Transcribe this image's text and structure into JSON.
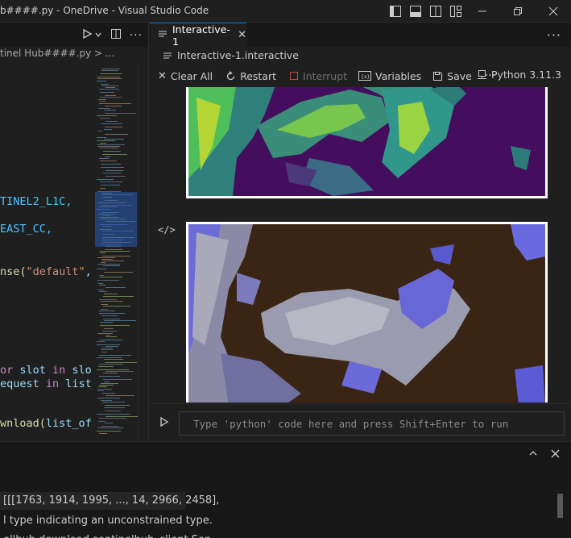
{
  "window": {
    "title": "b####.py - OneDrive - Visual Studio Code"
  },
  "left_editor": {
    "breadcrumb": "tinel Hub####.py > ...",
    "code_lines": [
      {
        "segments": [
          {
            "t": "TINEL2_L1C,",
            "c": "const"
          }
        ]
      },
      {
        "segments": [
          {
            "t": "EAST_CC,",
            "c": "const"
          }
        ]
      },
      {
        "segments": [
          {
            "t": "nse(",
            "c": "fn"
          },
          {
            "t": "\"default\"",
            "c": "str"
          },
          {
            "t": ", M",
            "c": "var"
          }
        ]
      },
      {
        "segments": [
          {
            "t": "or ",
            "c": "kw"
          },
          {
            "t": "slot ",
            "c": "var"
          },
          {
            "t": "in ",
            "c": "kw"
          },
          {
            "t": "slots",
            "c": "var"
          }
        ]
      },
      {
        "segments": [
          {
            "t": "equest ",
            "c": "var"
          },
          {
            "t": "in ",
            "c": "kw"
          },
          {
            "t": "list_o",
            "c": "var"
          }
        ]
      },
      {
        "segments": [
          {
            "t": "wnload(",
            "c": "fn"
          },
          {
            "t": "list_of_re",
            "c": "var"
          }
        ]
      }
    ]
  },
  "interactive": {
    "tab_label": "Interactive-1",
    "breadcrumb": "Interactive-1.interactive",
    "toolbar": {
      "clear_all": "Clear All",
      "restart": "Restart",
      "interrupt": "Interrupt",
      "variables": "Variables",
      "save": "Save",
      "kernel": "Python 3.11.3"
    },
    "input_placeholder": "Type 'python' code here and press Shift+Enter to run"
  },
  "bottom_panel": {
    "lines": [
      "[[[1763, 1914, 1995, ...,  14, 2966, 2458],",
      "l type indicating an unconstrained type.",
      "ellhub.download.sentinelhub_client.Sen"
    ]
  },
  "colors": {
    "accent": "#0078d4",
    "background": "#1f1f1f",
    "keyword": "#c586c0",
    "string": "#ce9178",
    "constant": "#4fc1ff"
  }
}
